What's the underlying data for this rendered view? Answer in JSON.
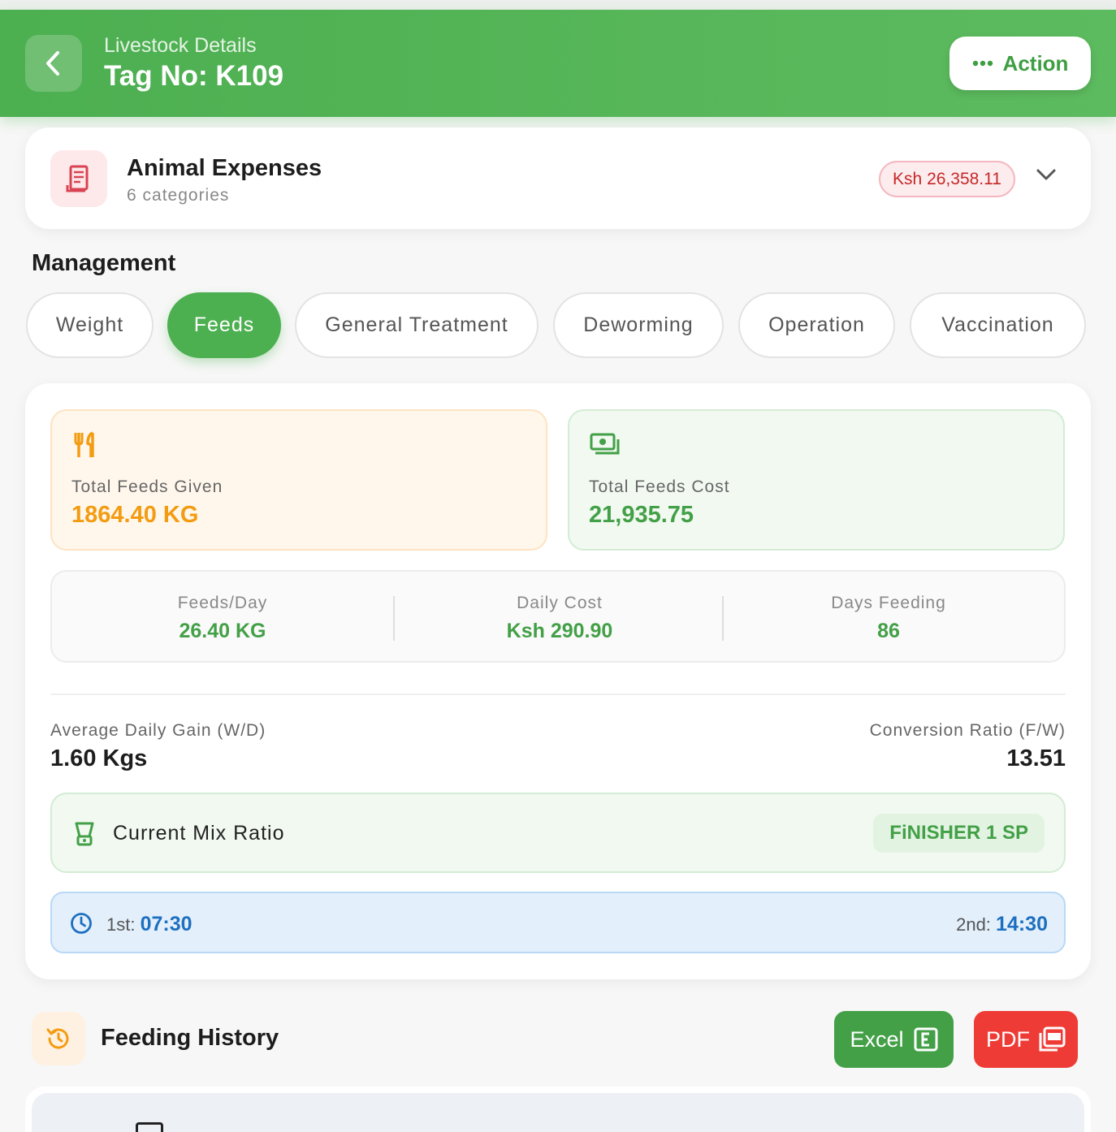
{
  "header": {
    "subtitle": "Livestock Details",
    "title": "Tag No: K109",
    "action_label": "Action"
  },
  "expenses": {
    "title": "Animal Expenses",
    "subtitle": "6 categories",
    "total": "Ksh 26,358.11"
  },
  "management": {
    "title": "Management",
    "tabs": [
      {
        "label": "Weight"
      },
      {
        "label": "Feeds"
      },
      {
        "label": "General Treatment"
      },
      {
        "label": "Deworming"
      },
      {
        "label": "Operation"
      },
      {
        "label": "Vaccination"
      }
    ],
    "active_tab": "Feeds"
  },
  "feeds": {
    "total_given": {
      "label": "Total Feeds Given",
      "value": "1864.40 KG"
    },
    "total_cost": {
      "label": "Total Feeds Cost",
      "value": "21,935.75"
    },
    "metrics": [
      {
        "label": "Feeds/Day",
        "value": "26.40 KG"
      },
      {
        "label": "Daily Cost",
        "value": "Ksh 290.90"
      },
      {
        "label": "Days Feeding",
        "value": "86"
      }
    ],
    "adg": {
      "label": "Average Daily Gain (W/D)",
      "value": "1.60 Kgs"
    },
    "conversion": {
      "label": "Conversion Ratio (F/W)",
      "value": "13.51"
    },
    "mix": {
      "label": "Current Mix Ratio",
      "value": "FiNISHER 1 SP"
    },
    "times": {
      "first_label": "1st:",
      "first_value": "07:30",
      "second_label": "2nd:",
      "second_value": "14:30"
    }
  },
  "history": {
    "title": "Feeding History",
    "excel_label": "Excel",
    "pdf_label": "PDF"
  },
  "colors": {
    "brand_green": "#4caf50",
    "expense_red": "#c62828",
    "feeds_orange": "#f39c12",
    "time_blue": "#1e6fbf",
    "pdf_red": "#ef3b36"
  }
}
